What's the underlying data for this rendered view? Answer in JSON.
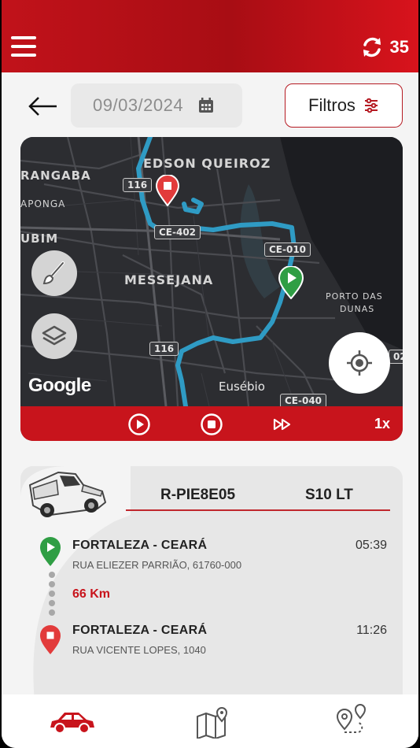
{
  "header": {
    "menu_icon": "hamburger-menu-icon",
    "refresh_icon": "refresh-icon",
    "refresh_count": "35",
    "bg_color": "#c1121a"
  },
  "toolbar": {
    "back_icon": "arrow-left-icon",
    "date": "09/03/2024",
    "calendar_icon": "calendar-icon",
    "filter_label": "Filtros",
    "filter_icon": "sliders-icon"
  },
  "map": {
    "labels": {
      "edson_queiroz": "EDSON QUEIROZ",
      "rangaba": "RANGABA",
      "aponga": "APONGA",
      "ubim": "UBIM",
      "messejana": "MESSEJANA",
      "porto_das": "PORTO DAS",
      "dunas": "DUNAS",
      "eusebio": "Eusébio"
    },
    "shields": {
      "s116_top": "116",
      "ce402": "CE-402",
      "ce010": "CE-010",
      "s116_bottom": "116",
      "ce040": "CE-040",
      "s02": "02"
    },
    "brush_icon": "brush-icon",
    "layers_icon": "layers-icon",
    "locate_icon": "crosshair-location-icon",
    "google": "Google",
    "route_color": "#2f9bc4",
    "start_pin_color": "#2f9e44",
    "end_pin_color": "#e23b3b"
  },
  "player": {
    "play_icon": "play-circle-icon",
    "stop_icon": "stop-circle-icon",
    "fast_forward_icon": "fast-forward-icon",
    "speed": "1x"
  },
  "trip": {
    "vehicle_icon": "pickup-truck-icon",
    "plate": "R-PIE8E05",
    "model": "S10 LT",
    "start": {
      "city": "FORTALEZA - CEARÁ",
      "address": "RUA ELIEZER PARRIÃO, 61760-000",
      "time": "05:39"
    },
    "distance": "66 Km",
    "end": {
      "city": "FORTALEZA - CEARÁ",
      "address": "RUA VICENTE LOPES, 1040",
      "time": "11:26"
    }
  },
  "bottom_nav": {
    "items": [
      {
        "icon": "car-icon",
        "active": true
      },
      {
        "icon": "map-icon",
        "active": false
      },
      {
        "icon": "route-icon",
        "active": false
      }
    ],
    "accent": "#c8141c"
  }
}
